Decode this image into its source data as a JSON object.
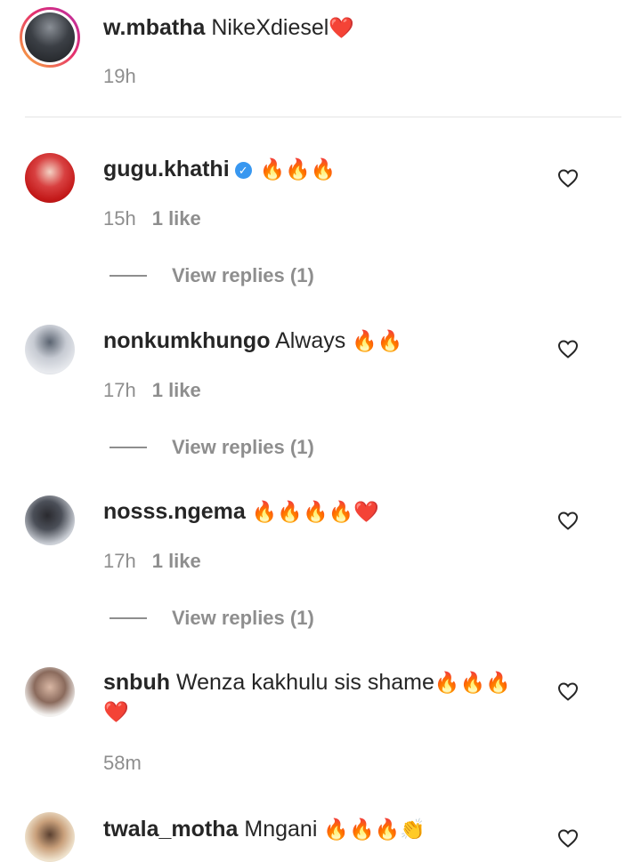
{
  "caption": {
    "username": "w.mbatha",
    "text": "NikeXdiesel",
    "emoji": "❤️",
    "time": "19h"
  },
  "comments": [
    {
      "username": "gugu.khathi",
      "verified": true,
      "text": "",
      "emoji": "🔥🔥🔥",
      "time": "15h",
      "likes": "1 like",
      "replies": "View replies (1)"
    },
    {
      "username": "nonkumkhungo",
      "text": "Always",
      "emoji": "🔥🔥",
      "time": "17h",
      "likes": "1 like",
      "replies": "View replies (1)"
    },
    {
      "username": "nosss.ngema",
      "text": "",
      "emoji": "🔥🔥🔥🔥❤️",
      "time": "17h",
      "likes": "1 like",
      "replies": "View replies (1)"
    },
    {
      "username": "snbuh",
      "text": "Wenza kakhulu sis shame",
      "emoji": "🔥🔥🔥❤️",
      "time": "58m"
    },
    {
      "username": "twala_motha",
      "text": "Mngani",
      "emoji": "🔥🔥🔥👏"
    }
  ],
  "icons": {
    "like": "heart-outline-icon",
    "verified": "verified-badge-icon"
  },
  "colors": {
    "verified": "#3897f0",
    "muted": "#8e8e8e",
    "text": "#262626",
    "heart": "#e0245e",
    "fire": "#f57c00"
  }
}
